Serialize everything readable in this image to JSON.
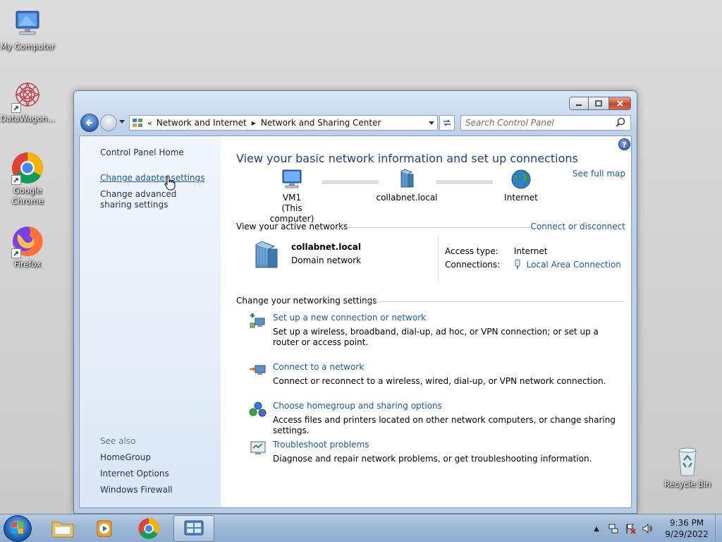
{
  "desktop": {
    "icons": [
      {
        "label": "My Computer"
      },
      {
        "label": "DataWagon..."
      },
      {
        "label": "Google Chrome"
      },
      {
        "label": "Firefox"
      },
      {
        "label": "Recycle Bin"
      }
    ]
  },
  "window": {
    "address": {
      "overflow": "«",
      "crumbs": [
        "Network and Internet",
        "Network and Sharing Center"
      ]
    },
    "search_placeholder": "Search Control Panel",
    "left_pane": {
      "home": "Control Panel Home",
      "links": [
        "Change adapter settings",
        "Change advanced sharing settings"
      ],
      "see_also_heading": "See also",
      "see_also": [
        "HomeGroup",
        "Internet Options",
        "Windows Firewall"
      ]
    },
    "main": {
      "help": "?",
      "title": "View your basic network information and set up connections",
      "see_full_map": "See full map",
      "map": {
        "computer_name": "VM1",
        "computer_sub": "(This computer)",
        "network_name": "collabnet.local",
        "internet": "Internet"
      },
      "active_networks": {
        "heading": "View your active networks",
        "action": "Connect or disconnect",
        "network_name": "collabnet.local",
        "network_type": "Domain network",
        "access_type_label": "Access type:",
        "access_type_value": "Internet",
        "connections_label": "Connections:",
        "connections_value": "Local Area Connection"
      },
      "settings": {
        "heading": "Change your networking settings",
        "tasks": [
          {
            "title": "Set up a new connection or network",
            "desc": "Set up a wireless, broadband, dial-up, ad hoc, or VPN connection; or set up a router or access point.",
            "icon": "new-connection-icon"
          },
          {
            "title": "Connect to a network",
            "desc": "Connect or reconnect to a wireless, wired, dial-up, or VPN network connection.",
            "icon": "connect-network-icon"
          },
          {
            "title": "Choose homegroup and sharing options",
            "desc": "Access files and printers located on other network computers, or change sharing settings.",
            "icon": "homegroup-icon"
          },
          {
            "title": "Troubleshoot problems",
            "desc": "Diagnose and repair network problems, or get troubleshooting information.",
            "icon": "troubleshoot-icon"
          }
        ]
      }
    }
  },
  "taskbar": {
    "clock_time": "9:36 PM",
    "clock_date": "9/29/2022"
  }
}
